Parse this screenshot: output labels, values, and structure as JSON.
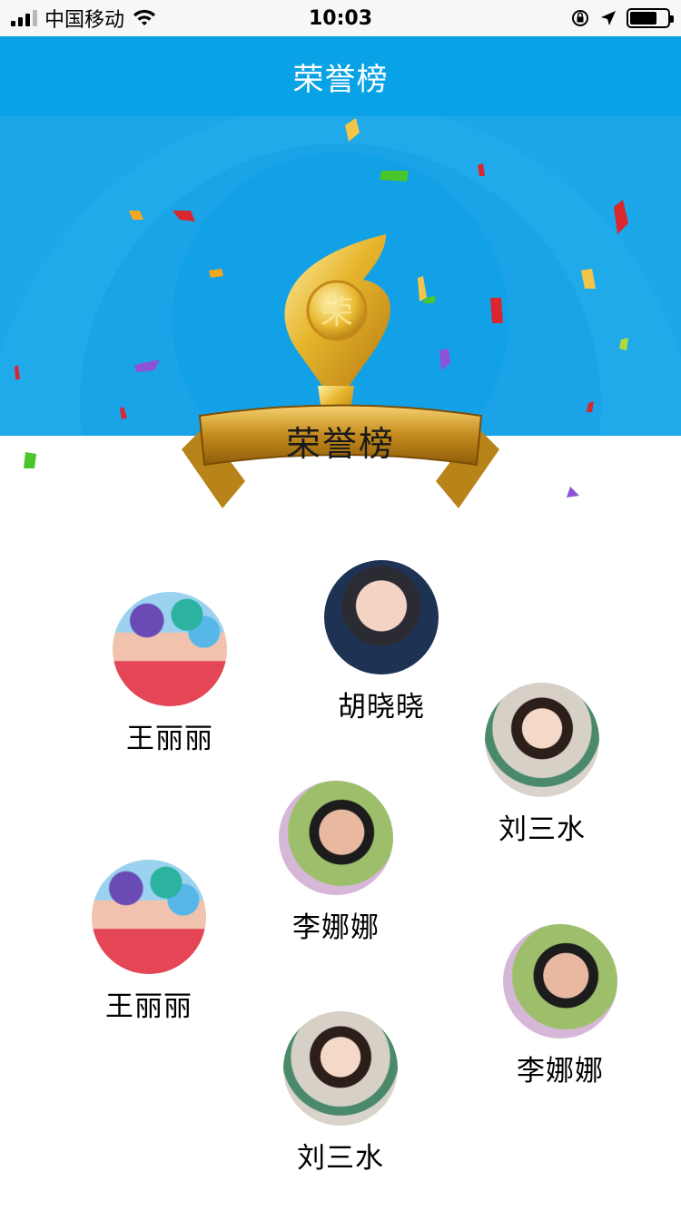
{
  "status_bar": {
    "carrier": "中国移动",
    "time": "10:03"
  },
  "navbar": {
    "title": "荣誉榜"
  },
  "banner": {
    "medal_char": "荣",
    "ribbon_text": "荣誉榜"
  },
  "people": [
    {
      "name": "胡晓晓",
      "avatar_style": "boy-portrait"
    },
    {
      "name": "王丽丽",
      "avatar_style": "group-balloons"
    },
    {
      "name": "刘三水",
      "avatar_style": "girl-portrait"
    },
    {
      "name": "李娜娜",
      "avatar_style": "man-portrait"
    },
    {
      "name": "王丽丽",
      "avatar_style": "group-balloons"
    },
    {
      "name": "李娜娜",
      "avatar_style": "man-portrait"
    },
    {
      "name": "刘三水",
      "avatar_style": "girl-portrait"
    }
  ],
  "colors": {
    "primary": "#0aa2e6",
    "banner": "#1ba7ea",
    "gold": "#d8a41f"
  }
}
